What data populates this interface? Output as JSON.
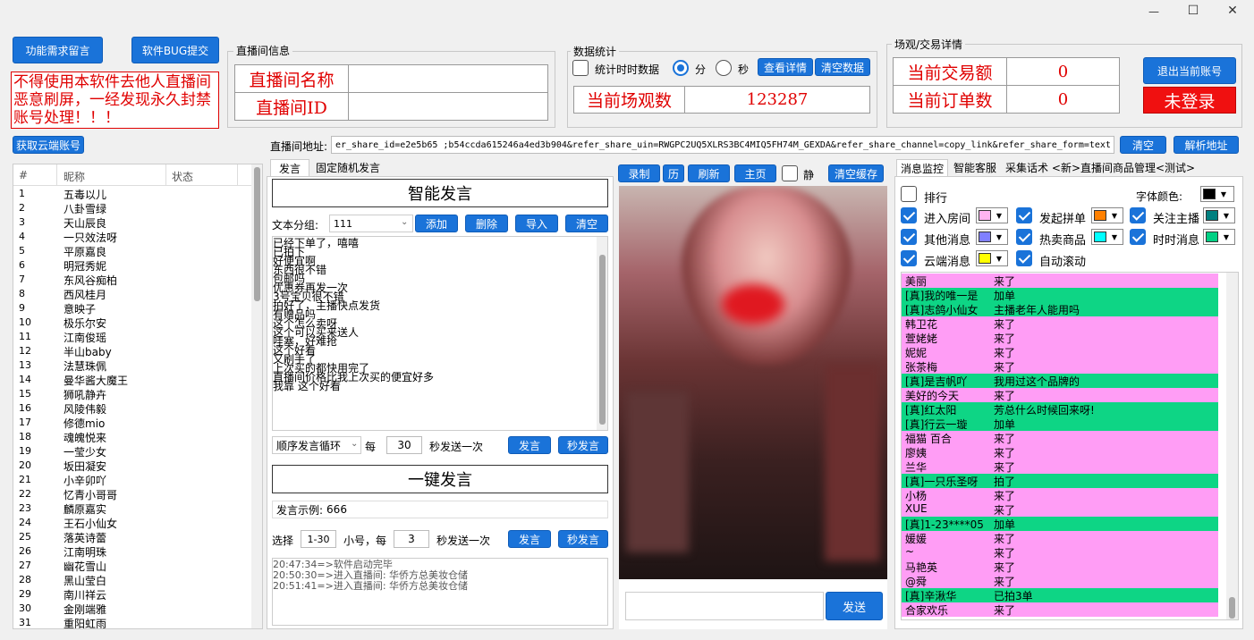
{
  "window": {
    "minimize": "—",
    "maximize": "☐",
    "close": "✕"
  },
  "top_buttons": {
    "feature_request": "功能需求留言",
    "bug_report": "软件BUG提交"
  },
  "warning_text": "不得使用本软件去他人直播间恶意刷屏，一经发现永久封禁账号处理！！！",
  "live_room_info": {
    "group_title": "直播间信息",
    "name_label": "直播间名称",
    "name_value": "",
    "id_label": "直播间ID",
    "id_value": ""
  },
  "stats": {
    "group_title": "数据统计",
    "realtime_label": "统计时时数据",
    "minute_label": "分",
    "second_label": "秒",
    "details_button": "查看详情",
    "clear_button": "清空数据",
    "views_label": "当前场观数",
    "views_value": "123287"
  },
  "trade": {
    "group_title": "场观/交易详情",
    "amount_label": "当前交易额",
    "amount_value": "0",
    "orders_label": "当前订单数",
    "orders_value": "0"
  },
  "account": {
    "logout_button": "退出当前账号",
    "status": "未登录"
  },
  "address_bar": {
    "cloud_button": "获取云端账号",
    "label": "直播间地址:",
    "value": "er_share_id=e2e5b65   ;b54ccda615246a4ed3b904&refer_share_uin=RWGPC2UQ5XLRS3BC4MIQ5FH74M_GEXDA&refer_share_channel=copy_link&refer_share_form=text",
    "clear_button": "清空",
    "parse_button": "解析地址"
  },
  "user_table": {
    "headers": [
      "#",
      "昵称",
      "状态"
    ],
    "rows": [
      [
        "1",
        "五毒以儿"
      ],
      [
        "2",
        "八卦雪绿"
      ],
      [
        "3",
        "天山辰良"
      ],
      [
        "4",
        "一只效法呀"
      ],
      [
        "5",
        "平原嘉良"
      ],
      [
        "6",
        "明冠秀妮"
      ],
      [
        "7",
        "东风谷痴柏"
      ],
      [
        "8",
        "西风桂月"
      ],
      [
        "9",
        "意映子"
      ],
      [
        "10",
        "极乐尔安"
      ],
      [
        "11",
        "江南俊瑶"
      ],
      [
        "12",
        "半山baby"
      ],
      [
        "13",
        "法慧珠佩"
      ],
      [
        "14",
        "曼华酱大魔王"
      ],
      [
        "15",
        "狮吼静卉"
      ],
      [
        "16",
        "风陵伟毅"
      ],
      [
        "17",
        "修德mio"
      ],
      [
        "18",
        "魂魄悦来"
      ],
      [
        "19",
        "一莹少女"
      ],
      [
        "20",
        "坂田凝安"
      ],
      [
        "21",
        "小辛卯吖"
      ],
      [
        "22",
        "忆青小哥哥"
      ],
      [
        "23",
        "麟原嘉实"
      ],
      [
        "24",
        "王石小仙女"
      ],
      [
        "25",
        "落英诗蕾"
      ],
      [
        "26",
        "江南明珠"
      ],
      [
        "27",
        "幽花雪山"
      ],
      [
        "28",
        "黑山莹白"
      ],
      [
        "29",
        "南川祥云"
      ],
      [
        "30",
        "金刚端雅"
      ],
      [
        "31",
        "重阳虹雨"
      ]
    ]
  },
  "speak_panel": {
    "tab_speak": "发言",
    "tab_fixed": "固定随机发言",
    "smart_title": "智能发言",
    "group_label": "文本分组:",
    "group_value": "111",
    "add_button": "添加",
    "delete_button": "删除",
    "import_button": "导入",
    "clear_button": "清空",
    "phrases": [
      "已经下单了，嘻嘻",
      "已拍下",
      "好便宜啊",
      "东西很不错",
      "包邮吗",
      "优惠券再发一次",
      "3号宝贝很不错",
      "拍好了，主播快点发货",
      "有赠品吗",
      "这个怎么卖呀",
      "这个可以买来送人",
      "哇塞，好难抢",
      "这个好看",
      "又刷手了",
      "上次买的都快用完了",
      "直播间价格比我上次买的便宜好多",
      "我靠  这个好看"
    ],
    "loop_mode": "顺序发言循环",
    "every_label": "每",
    "interval": "30",
    "interval_unit": "秒发送一次",
    "send_button": "发言",
    "sec_send_button": "秒发言",
    "one_key_title": "一键发言",
    "example_label": "发言示例:",
    "example_value": "666",
    "select_label": "选择",
    "select_range": "1-30",
    "small_label": "小号，每",
    "small_interval": "3",
    "small_unit": "秒发送一次",
    "send_button2": "发言",
    "sec_send_button2": "秒发言",
    "log": [
      "20:47:34=>软件启动完毕",
      "20:50:30=>进入直播间: 华侨方总美妆仓储",
      "20:51:41=>进入直播间: 华侨方总美妆仓储"
    ]
  },
  "video_panel": {
    "record_button": "录制",
    "history_button": "历",
    "refresh_button": "刷新",
    "home_button": "主页",
    "mute_label": "静",
    "clear_cache_button": "清空缓存",
    "send_button": "发送",
    "input_value": ""
  },
  "monitor_panel": {
    "tabs": [
      "消息监控",
      "智能客服",
      "采集话术",
      "<新>直播间商品管理<测试>"
    ],
    "sort_label": "排行",
    "font_color_label": "字体颜色:",
    "font_color": "#000000",
    "options": [
      {
        "label": "进入房间",
        "color": "#ffb4f0",
        "checked": true
      },
      {
        "label": "发起拼单",
        "color": "#ff8000",
        "checked": true
      },
      {
        "label": "关注主播",
        "color": "#008080",
        "checked": true
      },
      {
        "label": "其他消息",
        "color": "#8080ff",
        "checked": true
      },
      {
        "label": "热卖商品",
        "color": "#00ffff",
        "checked": true
      },
      {
        "label": "时时消息",
        "color": "#00d084",
        "checked": true
      },
      {
        "label": "云端消息",
        "color": "#ffff00",
        "checked": true
      },
      {
        "label": "自动滚动",
        "checked": true
      }
    ],
    "colors": {
      "pink": "#ff9df5",
      "green": "#0ed585"
    },
    "messages": [
      [
        "美丽",
        "来了",
        "pink"
      ],
      [
        "[真]我的唯一是",
        "加单",
        "green"
      ],
      [
        "[真]志鸽小仙女",
        "主播老年人能用吗",
        "green"
      ],
      [
        "韩卫花",
        "来了",
        "pink"
      ],
      [
        "萱姥姥",
        "来了",
        "pink"
      ],
      [
        " 妮妮",
        "来了",
        "pink"
      ],
      [
        "张茶梅",
        "来了",
        "pink"
      ],
      [
        "[真]是吉帆吖",
        "我用过这个品牌的",
        "green"
      ],
      [
        "美好的今天",
        "来了",
        "pink"
      ],
      [
        "[真]红太阳",
        "芳总什么时候回来呀!",
        "green"
      ],
      [
        "[真]行云一璇",
        "加单",
        "green"
      ],
      [
        "福猫 百合",
        "来了",
        "pink"
      ],
      [
        "廖姨",
        "来了",
        "pink"
      ],
      [
        "兰华",
        "来了",
        "pink"
      ],
      [
        "[真]一只乐圣呀",
        "拍了",
        "green"
      ],
      [
        "小杨",
        "来了",
        "pink"
      ],
      [
        "XUE",
        "来了",
        "pink"
      ],
      [
        "[真]1-23****05",
        "加单",
        "green"
      ],
      [
        "媛媛",
        "来了",
        "pink"
      ],
      [
        "~",
        "来了",
        "pink"
      ],
      [
        "马艳英",
        "来了",
        "pink"
      ],
      [
        "@舜",
        "来了",
        "pink"
      ],
      [
        "[真]辛湫华",
        "已拍3单",
        "green"
      ],
      [
        "合家欢乐",
        "来了",
        "pink"
      ]
    ]
  }
}
